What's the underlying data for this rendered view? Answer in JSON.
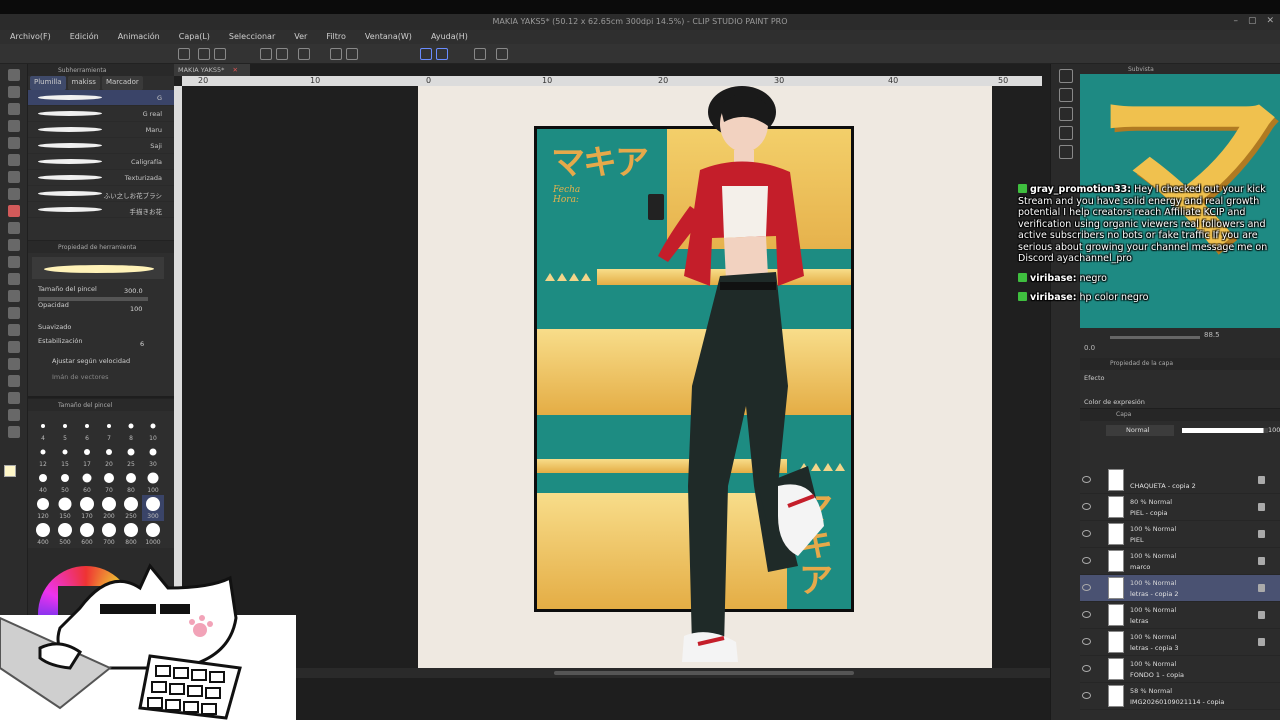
{
  "titlebar": {
    "title": "MAKIA YAKS5* (50.12 x 62.65cm 300dpi 14.5%) - CLIP STUDIO PAINT PRO"
  },
  "menu": [
    "Archivo(F)",
    "Edición",
    "Animación",
    "Capa(L)",
    "Seleccionar",
    "Ver",
    "Filtro",
    "Ventana(W)",
    "Ayuda(H)"
  ],
  "subtool": {
    "header": "Subherramienta",
    "tabs": [
      "Plumilla",
      "makiss",
      "Marcador"
    ],
    "brushes": [
      "G",
      "G real",
      "Maru",
      "Saji",
      "Caligrafía",
      "Texturizada",
      "ふい之しお花ブラシ",
      "手描きお花"
    ]
  },
  "toolprop": {
    "header": "Propiedad de herramienta",
    "brush_size_label": "Tamaño del pincel",
    "brush_size": "300.0",
    "opacity_label": "Opacidad",
    "opacity": "100",
    "smoothing_label": "Suavizado",
    "stabilization_label": "Estabilización",
    "stabilization": "6",
    "speed_label": "Ajustar según velocidad",
    "vector_label": "Imán de vectores"
  },
  "brushsize": {
    "header": "Tamaño del pincel",
    "sizes": [
      "4",
      "5",
      "6",
      "7",
      "8",
      "10",
      "12",
      "15",
      "17",
      "20",
      "25",
      "30",
      "40",
      "50",
      "60",
      "70",
      "80",
      "100",
      "120",
      "150",
      "170",
      "200",
      "250",
      "300",
      "400",
      "500",
      "600",
      "700",
      "800",
      "1000"
    ]
  },
  "canvas": {
    "tab": "MAKIA YAKS5*",
    "ruler": [
      "20",
      "10",
      "0",
      "10",
      "20",
      "30",
      "40",
      "50"
    ],
    "fecha": "Fecha",
    "hora": "Hora:",
    "kana_top": "マキア",
    "kana_side": "マキア"
  },
  "subview": {
    "header": "Subvista",
    "glyph": "マ"
  },
  "navigator": {
    "zoom": "88.5",
    "rotation": "0.0"
  },
  "layerprop": {
    "header": "Propiedad de la capa",
    "effect": "Efecto",
    "expr": "Color de expresión"
  },
  "layers": {
    "tabs": "Capa",
    "blend": "Normal",
    "opacity": "100",
    "items": [
      {
        "mode": "",
        "name": "CHAQUETA - copia 2"
      },
      {
        "mode": "80 % Normal",
        "name": "PIEL - copia"
      },
      {
        "mode": "100 % Normal",
        "name": "PIEL"
      },
      {
        "mode": "100 % Normal",
        "name": "marco"
      },
      {
        "mode": "100 % Normal",
        "name": "letras - copia 2"
      },
      {
        "mode": "100 % Normal",
        "name": "letras"
      },
      {
        "mode": "100 % Normal",
        "name": "letras - copia 3"
      },
      {
        "mode": "100 % Normal",
        "name": "FONDO 1 - copia"
      },
      {
        "mode": "58 % Normal",
        "name": "IMG20260109021114 - copia"
      }
    ]
  },
  "chat": [
    {
      "user": "gray_promotion33:",
      "text": "Hey I checked out your kick Stream and you have solid energy and real growth potential I help creators reach Affiliate KCIP and verification using organic viewers real followers and active subscribers no bots or fake traffic If you are serious about growing your channel message me on Discord ayachannel_pro"
    },
    {
      "user": "viribase:",
      "text": "negro"
    },
    {
      "user": "viribase:",
      "text": "hp color negro"
    }
  ],
  "colors": {
    "teal": "#1d8c82",
    "gold": "#e6b24c",
    "selection": "#4a5272"
  }
}
